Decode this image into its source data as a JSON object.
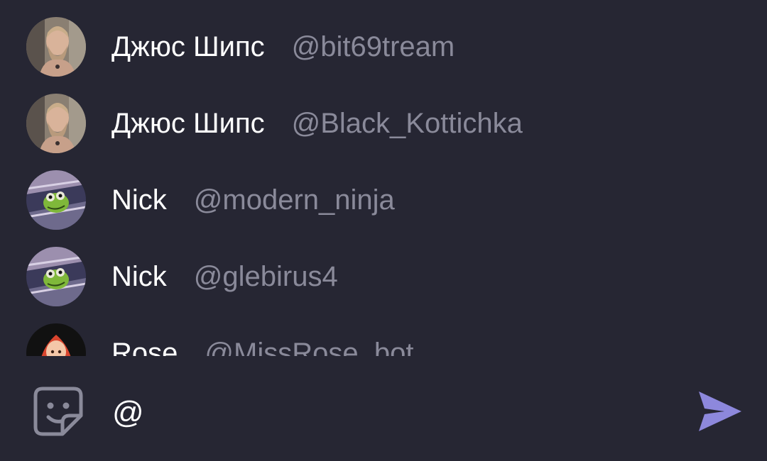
{
  "mentions": [
    {
      "display_name": "Джюс Шипс",
      "username": "@bit69tream",
      "avatar": "bearded-man-photo"
    },
    {
      "display_name": "Джюс Шипс",
      "username": "@Black_Kottichka",
      "avatar": "bearded-man-photo"
    },
    {
      "display_name": "Nick",
      "username": "@modern_ninja",
      "avatar": "frog-puppet-photo"
    },
    {
      "display_name": "Nick",
      "username": "@glebirus4",
      "avatar": "frog-puppet-photo"
    },
    {
      "display_name": "Rose",
      "username": "@MissRose_bot",
      "avatar": "red-haired-girl-cartoon"
    }
  ],
  "composer": {
    "input_value": "@",
    "sticker_icon": "sticker-icon",
    "send_icon": "send-icon"
  },
  "colors": {
    "background": "#262633",
    "username_gray": "#8a8a9a",
    "send_accent": "#8d88dc"
  }
}
